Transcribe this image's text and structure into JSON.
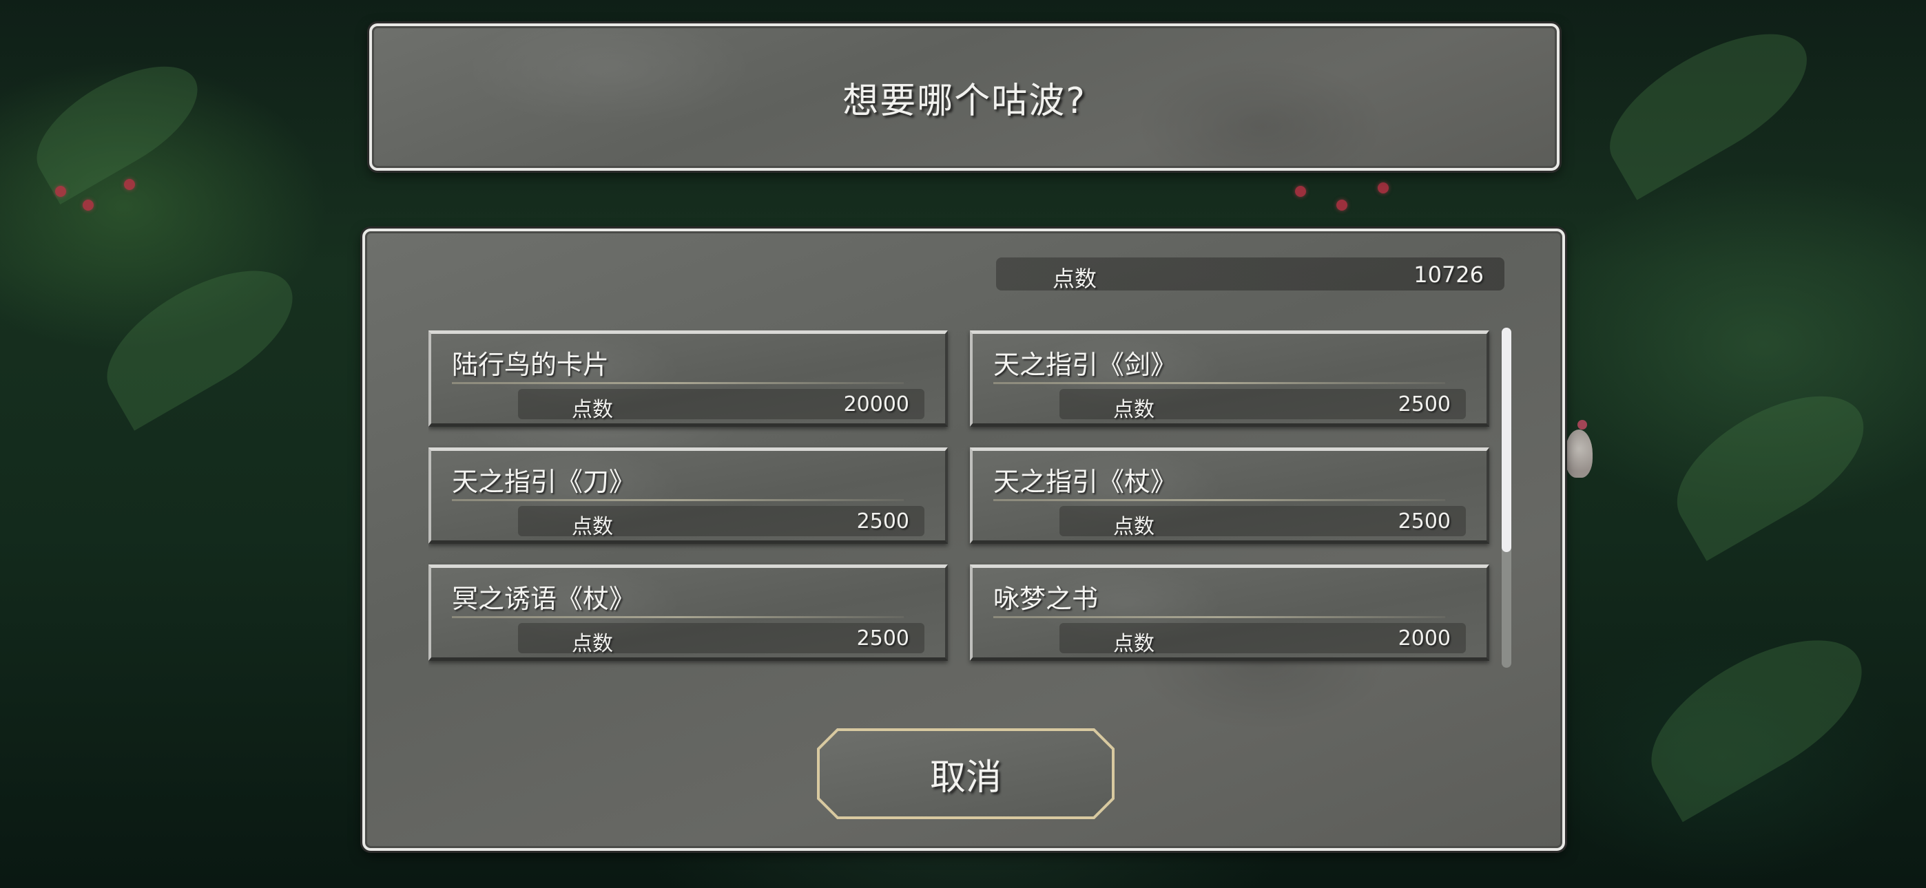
{
  "dialog": {
    "question": "想要哪个咕波?"
  },
  "points": {
    "label": "点数",
    "value": "10726"
  },
  "items": [
    {
      "name": "陆行鸟的卡片",
      "cost_label": "点数",
      "cost": "20000"
    },
    {
      "name": "天之指引《剑》",
      "cost_label": "点数",
      "cost": "2500"
    },
    {
      "name": "天之指引《刀》",
      "cost_label": "点数",
      "cost": "2500"
    },
    {
      "name": "天之指引《杖》",
      "cost_label": "点数",
      "cost": "2500"
    },
    {
      "name": "冥之诱语《杖》",
      "cost_label": "点数",
      "cost": "2500"
    },
    {
      "name": "咏梦之书",
      "cost_label": "点数",
      "cost": "2000"
    },
    {
      "name": "",
      "cost_label": "",
      "cost": ""
    },
    {
      "name": "",
      "cost_label": "",
      "cost": ""
    }
  ],
  "scroll": {
    "position": 0
  },
  "cancel_button": {
    "label": "取消"
  },
  "colors": {
    "panel_stone": "#646662",
    "panel_border": "#e9e9e6",
    "button_border": "#d8c9a0",
    "text": "#f3f3f0"
  }
}
